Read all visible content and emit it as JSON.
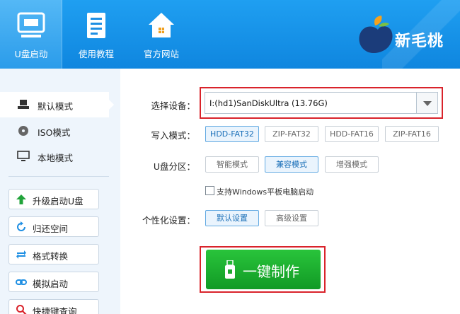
{
  "header": {
    "nav": [
      {
        "label": "U盘启动",
        "icon": "usb-drive-icon",
        "active": true
      },
      {
        "label": "使用教程",
        "icon": "document-icon",
        "active": false
      },
      {
        "label": "官方网站",
        "icon": "home-icon",
        "active": false
      }
    ],
    "brand": "新毛桃"
  },
  "sidebar": {
    "modes": [
      {
        "label": "默认模式",
        "icon": "usb-mode-icon",
        "active": true
      },
      {
        "label": "ISO模式",
        "icon": "disc-icon",
        "active": false
      },
      {
        "label": "本地模式",
        "icon": "monitor-icon",
        "active": false
      }
    ],
    "tools": [
      {
        "label": "升级启动U盘",
        "icon": "arrow-up-icon"
      },
      {
        "label": "归还空间",
        "icon": "refresh-icon"
      },
      {
        "label": "格式转换",
        "icon": "swap-icon"
      },
      {
        "label": "模拟启动",
        "icon": "link-icon"
      },
      {
        "label": "快捷键查询",
        "icon": "search-icon"
      }
    ]
  },
  "main": {
    "device_label": "选择设备：",
    "device_value": "I:(hd1)SanDiskUltra (13.76G)",
    "write_mode_label": "写入模式：",
    "write_modes": [
      "HDD-FAT32",
      "ZIP-FAT32",
      "HDD-FAT16",
      "ZIP-FAT16"
    ],
    "write_mode_selected": "HDD-FAT32",
    "partition_label": "U盘分区：",
    "partitions": [
      "智能模式",
      "兼容模式",
      "增强模式"
    ],
    "partition_selected": "兼容模式",
    "windows_tablet_label": "支持Windows平板电脑启动",
    "windows_tablet_checked": false,
    "personalize_label": "个性化设置：",
    "personalize_options": [
      "默认设置",
      "高级设置"
    ],
    "personalize_selected": "默认设置",
    "make_button": "一键制作"
  },
  "colors": {
    "header": "#1a95ec",
    "accent_red": "#d9232b",
    "go_green": "#1fb032"
  }
}
